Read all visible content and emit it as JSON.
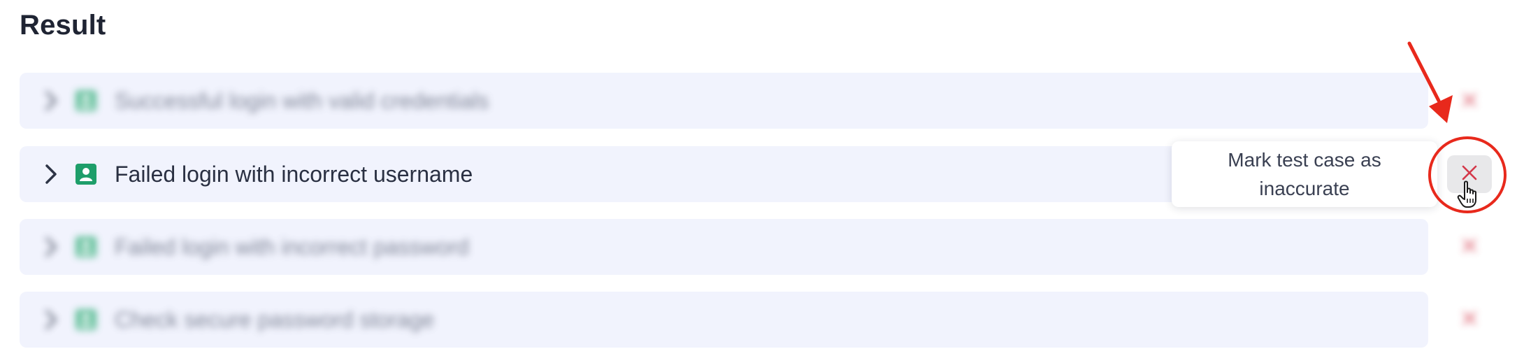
{
  "header": {
    "title": "Result"
  },
  "rows": [
    {
      "label": "Successful login with valid credentials",
      "state": "blurred"
    },
    {
      "label": "Failed login with incorrect username",
      "state": "focused"
    },
    {
      "label": "Failed login with incorrect password",
      "state": "blurred"
    },
    {
      "label": "Check secure password storage",
      "state": "blurred"
    }
  ],
  "tooltip": {
    "text": "Mark test case as inaccurate"
  },
  "icons": {
    "expand": "chevron-right-icon",
    "status": "user-badge-icon",
    "remove": "close-icon",
    "pointer": "hand-pointer-icon",
    "annotation": "red-arrow"
  },
  "colors": {
    "row_background": "#f1f3fd",
    "status_green": "#1e9e6a",
    "close_red": "#d4384a",
    "annotation_red": "#e8291c"
  }
}
